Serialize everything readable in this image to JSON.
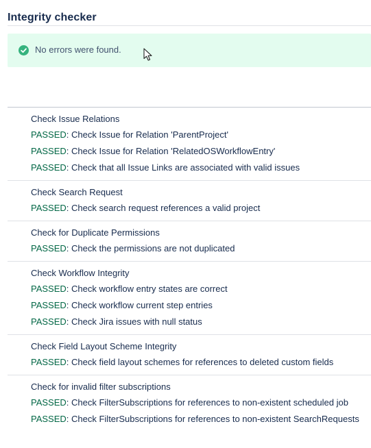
{
  "page_title": "Integrity checker",
  "success_message": {
    "icon": "check-circle-icon",
    "color": "#36b37e",
    "text": "No errors were found."
  },
  "passed_color": "#006644",
  "groups": [
    {
      "title": "Check Issue Relations",
      "checks": [
        {
          "status": "PASSED",
          "text": "Check Issue for Relation 'ParentProject'"
        },
        {
          "status": "PASSED",
          "text": "Check Issue for Relation 'RelatedOSWorkflowEntry'"
        },
        {
          "status": "PASSED",
          "text": "Check that all Issue Links are associated with valid issues"
        }
      ]
    },
    {
      "title": "Check Search Request",
      "checks": [
        {
          "status": "PASSED",
          "text": "Check search request references a valid project"
        }
      ]
    },
    {
      "title": "Check for Duplicate Permissions",
      "checks": [
        {
          "status": "PASSED",
          "text": "Check the permissions are not duplicated"
        }
      ]
    },
    {
      "title": "Check Workflow Integrity",
      "checks": [
        {
          "status": "PASSED",
          "text": "Check workflow entry states are correct"
        },
        {
          "status": "PASSED",
          "text": "Check workflow current step entries"
        },
        {
          "status": "PASSED",
          "text": "Check Jira issues with null status"
        }
      ]
    },
    {
      "title": "Check Field Layout Scheme Integrity",
      "checks": [
        {
          "status": "PASSED",
          "text": "Check field layout schemes for references to deleted custom fields"
        }
      ]
    },
    {
      "title": "Check for invalid filter subscriptions",
      "checks": [
        {
          "status": "PASSED",
          "text": "Check FilterSubscriptions for references to non-existent scheduled job"
        },
        {
          "status": "PASSED",
          "text": "Check FilterSubscriptions for references to non-existent SearchRequests"
        }
      ]
    }
  ]
}
